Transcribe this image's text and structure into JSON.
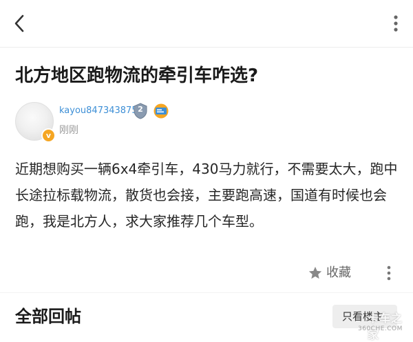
{
  "header": {
    "back_icon": "chevron-left-icon",
    "more_icon": "more-vertical-icon"
  },
  "post": {
    "title": "北方地区跑物流的牵引车咋选?",
    "author": {
      "username": "kayou847343875",
      "level": "2",
      "avatar_badge": "v",
      "time": "刚刚"
    },
    "content": "近期想购买一辆6x4牵引车，430马力就行，不需要太大，跑中长途拉标载物流，散货也会接，主要跑高速，国道有时候也会跑，我是北方人，求大家推荐几个车型。",
    "actions": {
      "favorite_label": "收藏",
      "favorite_icon": "star-icon",
      "more_icon": "more-vertical-icon"
    }
  },
  "replies": {
    "section_title": "全部回帖",
    "filter_label": "只看楼主"
  },
  "watermark": {
    "text": "卡车之家",
    "url": "360CHE.COM"
  },
  "colors": {
    "username": "#3d8fd6",
    "badge_orange": "#f5a623",
    "level_badge": "#8a9bb0"
  }
}
